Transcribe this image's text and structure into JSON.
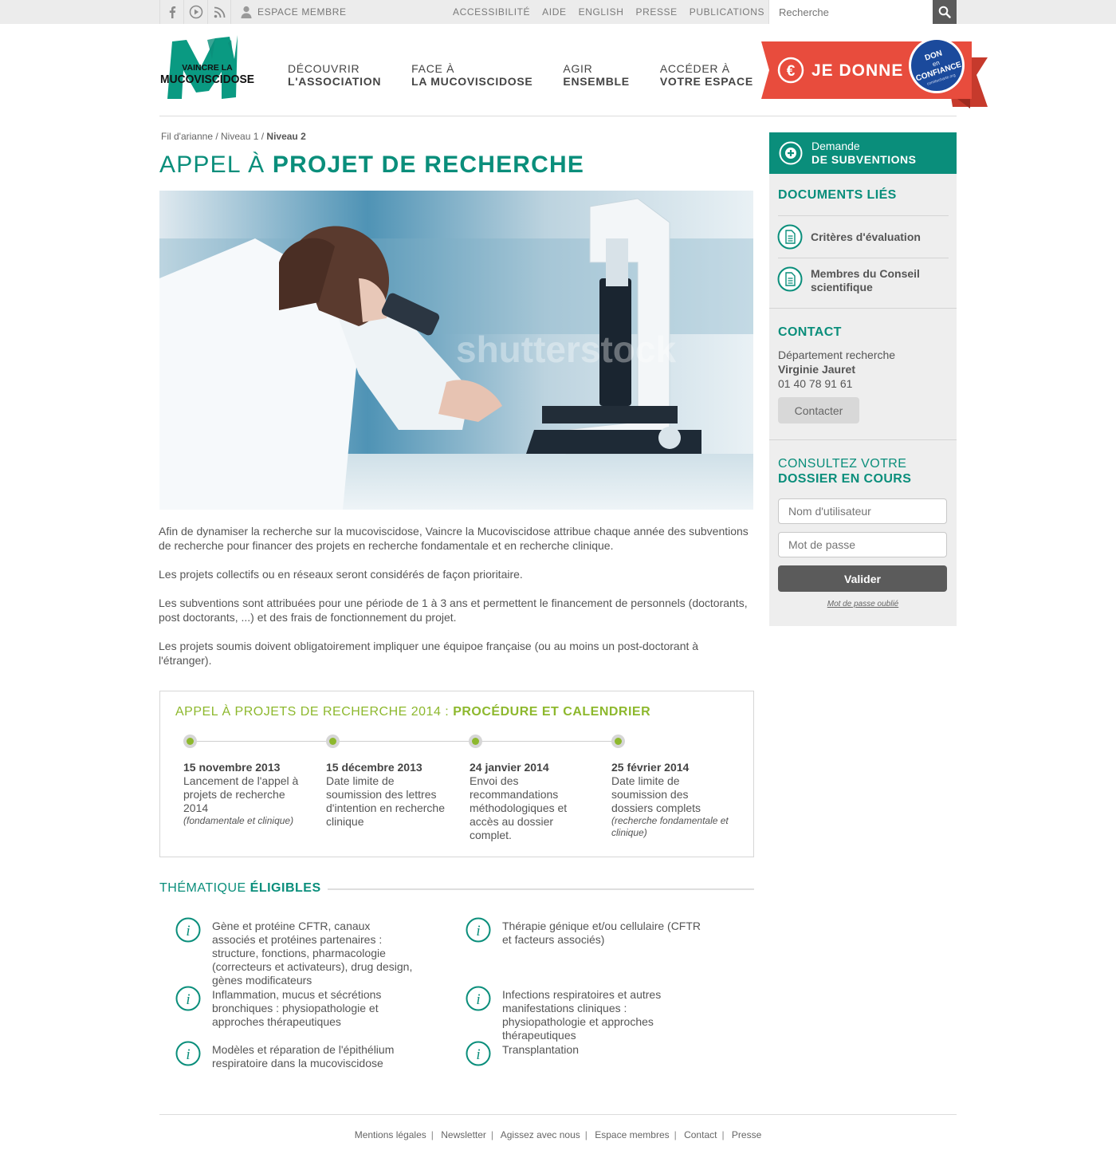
{
  "topbar": {
    "member_label": "ESPACE MEMBRE",
    "links": [
      "ACCESSIBILITÉ",
      "AIDE",
      "ENGLISH",
      "PRESSE",
      "PUBLICATIONS"
    ],
    "search_placeholder": "Recherche"
  },
  "logo": {
    "line1": "VAINCRE LA",
    "line2": "MUCOVISCIDOSE"
  },
  "nav": [
    {
      "line1": "DÉCOUVRIR",
      "line2": "L'ASSOCIATION"
    },
    {
      "line1": "FACE À",
      "line2": "LA MUCOVISCIDOSE"
    },
    {
      "line1": "AGIR",
      "line2": "ENSEMBLE"
    },
    {
      "line1": "ACCÉDER À",
      "line2": "VOTRE ESPACE"
    }
  ],
  "donate": {
    "label": "JE DONNE",
    "badge_top": "DON",
    "badge_mid": "en",
    "badge_bottom": "CONFIANCE",
    "badge_small": "comitecharte.org"
  },
  "breadcrumb": {
    "root": "Fil d'arianne",
    "level1": "Niveau 1",
    "level2": "Niveau 2"
  },
  "title": {
    "light": "APPEL À ",
    "bold": "PROJET DE RECHERCHE"
  },
  "intro": [
    "Afin de dynamiser la recherche sur la mucoviscidose, Vaincre la Mucoviscidose attribue chaque année des subventions de recherche pour financer des projets en recherche fondamentale et en recherche clinique.",
    "Les projets collectifs ou en réseaux seront considérés de façon prioritaire.",
    "Les subventions sont attribuées pour une période de 1 à 3 ans et permettent le financement de personnels (doctorants, post doctorants, ...) et des frais de fonctionnement du projet.",
    "Les projets soumis doivent obligatoirement impliquer une équipoe française (ou au moins un post-doctorant à l'étranger)."
  ],
  "timeline": {
    "title_light": "APPEL À PROJETS DE RECHERCHE 2014 : ",
    "title_bold": "PROCÉDURE ET CALENDRIER",
    "steps": [
      {
        "date": "15 novembre 2013",
        "text": "Lancement de l'appel à projets de recherche 2014",
        "note": "(fondamentale et clinique)"
      },
      {
        "date": "15 décembre 2013",
        "text": "Date limite de soumission des lettres d'intention en recherche clinique",
        "note": ""
      },
      {
        "date": "24 janvier 2014",
        "text": "Envoi des recommandations méthodologiques et accès au dossier complet.",
        "note": ""
      },
      {
        "date": "25 février 2014",
        "text": "Date limite de soumission des dossiers complets",
        "note": "(recherche fondamentale et clinique)"
      }
    ]
  },
  "thematique": {
    "title_light": "THÉMATIQUE ",
    "title_bold": "ÉLIGIBLES",
    "items": [
      "Gène et protéine CFTR, canaux associés et protéines partenaires : structure, fonctions, pharmacologie (correcteurs et activateurs), drug design, gènes modificateurs",
      "Thérapie génique et/ou cellulaire (CFTR et facteurs associés)",
      "Inflammation, mucus et sécrétions bronchiques : physiopathologie et approches thérapeutiques",
      "Infections respiratoires et autres manifestations cliniques : physiopathologie et approches thérapeutiques",
      "Modèles et réparation de l'épithélium respiratoire dans la mucoviscidose",
      "Transplantation"
    ]
  },
  "sidebar": {
    "request_line1": "Demande",
    "request_line2": "DE SUBVENTIONS",
    "docs_title": "DOCUMENTS LIÉS",
    "docs": [
      "Critères d'évaluation",
      "Membres du Conseil scientifique"
    ],
    "contact_title": "CONTACT",
    "contact_dept": "Département recherche",
    "contact_name": "Virginie Jauret",
    "contact_phone": "01 40 78 91 61",
    "contact_button": "Contacter",
    "dossier_line1": "CONSULTEZ VOTRE",
    "dossier_line2": "DOSSIER EN COURS",
    "username_placeholder": "Nom d'utilisateur",
    "password_placeholder": "Mot de passe",
    "submit": "Valider",
    "forgot": "Mot de passe oublié"
  },
  "footer": [
    "Mentions légales",
    "Newsletter",
    "Agissez avec nous",
    "Espace membres",
    "Contact",
    "Presse"
  ],
  "colors": {
    "primary": "#0a8e7b",
    "accent_green": "#8db82d",
    "donate_red": "#e84c3d",
    "badge_blue": "#1b4a9c"
  },
  "image": {
    "watermark": "shutterstock"
  }
}
